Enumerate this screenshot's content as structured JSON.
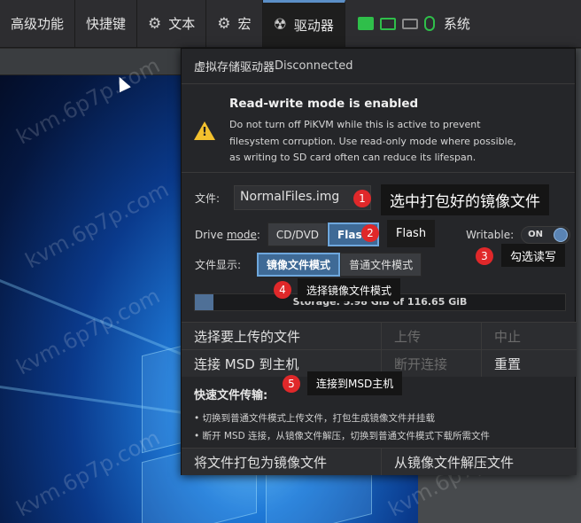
{
  "menubar": {
    "items": [
      {
        "label": "高级功能"
      },
      {
        "label": "快捷键"
      },
      {
        "label": "文本"
      },
      {
        "label": "宏"
      },
      {
        "label": "驱动器"
      }
    ],
    "system_label": "系统"
  },
  "watermark": "kvm.6p7p.com",
  "drive": {
    "header_title": "虚拟存储驱动器",
    "header_status": "Disconnected",
    "warning_title": "Read-write mode is enabled",
    "warning_lines": [
      "Do not turn off PiKVM while this is active to prevent",
      "filesystem corruption. Use read-only mode where possible,",
      "as writing to SD card often can reduce its lifespan."
    ],
    "file_label": "文件:",
    "file_value": "NormalFiles.img",
    "mode_label_prefix": "Drive ",
    "mode_label_link": "mode",
    "mode_label_suffix": ":",
    "mode_options": [
      "CD/DVD",
      "Flash"
    ],
    "mode_selected": "Flash",
    "writable_label": "Writable:",
    "writable_state": "ON",
    "display_label": "文件显示:",
    "display_options": [
      "镜像文件模式",
      "普通文件模式"
    ],
    "display_selected": "镜像文件模式",
    "storage_text": "Storage: 5.98 GiB of 116.65 GiB",
    "storage_fraction": 0.05,
    "upload_label": "选择要上传的文件",
    "upload_btn": "上传",
    "abort_btn": "中止",
    "connect_label": "连接 MSD 到主机",
    "disconnect_btn": "断开连接",
    "reset_btn": "重置",
    "quick_title": "快速文件传输:",
    "quick_items": [
      "• 切换到普通文件模式上传文件，打包生成镜像文件并挂载",
      "• 断开 MSD 连接，从镜像文件解压，切换到普通文件模式下载所需文件"
    ],
    "pack_btn": "将文件打包为镜像文件",
    "unpack_btn": "从镜像文件解压文件"
  },
  "annotations": [
    {
      "num": "1",
      "text": "选中打包好的镜像文件"
    },
    {
      "num": "2",
      "text": "Flash"
    },
    {
      "num": "3",
      "text": "勾选读写"
    },
    {
      "num": "4",
      "text": "选择镜像文件模式"
    },
    {
      "num": "5",
      "text": "连接到MSD主机"
    }
  ],
  "colors": {
    "accent": "#3f6a96",
    "warning": "#f3c12e",
    "annotation": "#e0282a",
    "led_green": "#2fbf4a"
  }
}
